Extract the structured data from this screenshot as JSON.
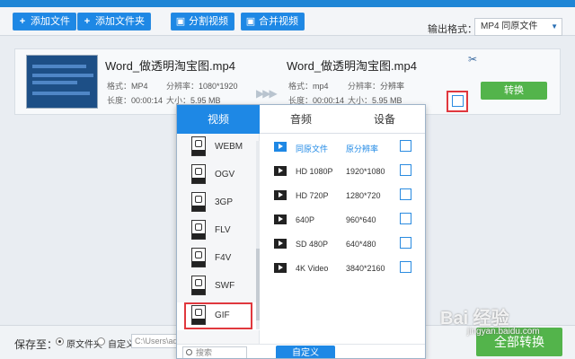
{
  "toolbar": {
    "add_file": "添加文件",
    "add_folder": "添加文件夹",
    "split_video": "分割视频",
    "merge_video": "合并视频",
    "output_format_label": "输出格式：",
    "output_format_value": "MP4 同原文件"
  },
  "file": {
    "src_name": "Word_做透明淘宝图.mp4",
    "src_format_label": "格式：",
    "src_format": "MP4",
    "src_res_label": "分辨率：",
    "src_res": "1080*1920",
    "src_len_label": "长度：",
    "src_len": "00:00:14",
    "src_size_label": "大小：",
    "src_size": "5.95 MB",
    "dst_name": "Word_做透明淘宝图.mp4",
    "dst_format": "mp4",
    "dst_res": "分辨率",
    "dst_len": "00:00:14",
    "dst_size": "5.95 MB",
    "convert_label": "转换"
  },
  "popup": {
    "tabs": [
      "视频",
      "音频",
      "设备"
    ],
    "active_tab": 0,
    "formats": [
      "WEBM",
      "OGV",
      "3GP",
      "FLV",
      "F4V",
      "SWF",
      "GIF"
    ],
    "selected_format": "GIF",
    "qualities": [
      {
        "name": "同原文件",
        "res": "原分辨率"
      },
      {
        "name": "HD 1080P",
        "res": "1920*1080"
      },
      {
        "name": "HD 720P",
        "res": "1280*720"
      },
      {
        "name": "640P",
        "res": "960*640"
      },
      {
        "name": "SD 480P",
        "res": "640*480"
      },
      {
        "name": "4K Video",
        "res": "3840*2160"
      }
    ],
    "search_placeholder": "搜索",
    "custom_label": "自定义"
  },
  "bottom": {
    "save_label": "保存至：",
    "opt_source": "原文件夹",
    "opt_custom": "自定义",
    "path": "C:\\Users\\ad",
    "convert_all": "全部转换"
  },
  "watermark": {
    "text": "Bai 经验",
    "url": "jingyan.baidu.com"
  },
  "colors": {
    "accent": "#1e88e5",
    "convert": "#53b44b",
    "highlight": "#e0383e"
  }
}
